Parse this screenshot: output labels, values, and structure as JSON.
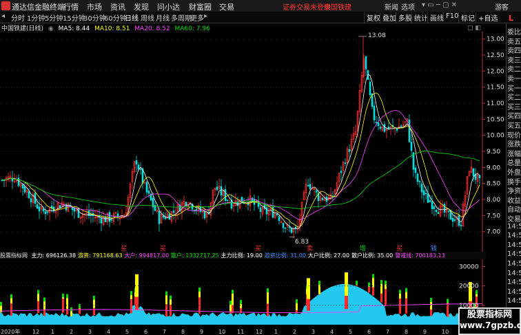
{
  "menu": {
    "app_title": "通达信金融终端",
    "items": [
      "行情",
      "市场",
      "资讯",
      "发现",
      "问小达",
      "财富圈",
      "交易"
    ],
    "warning": "证券交易未登录",
    "stock_link": "中国铁建",
    "right_items": [
      "新闻",
      "选项"
    ],
    "user": "游客"
  },
  "toolbar": {
    "periods": [
      "分时",
      "1分钟",
      "5分钟",
      "15分钟",
      "30分钟",
      "60分钟",
      "日线",
      "周线",
      "月线",
      "多周期",
      "更多"
    ],
    "active_period": "日线",
    "right_buttons": [
      "复权",
      "叠加",
      "多股",
      "统计",
      "画线",
      "F10",
      "标记",
      "+自选"
    ]
  },
  "legend": {
    "name": "中国铁建(日线)",
    "ma5": "MA5: 8.44",
    "ma10": "MA10: 8.51",
    "ma20": "MA20: 8.52",
    "ma60": "MA60: 7.96",
    "colors": {
      "ma5": "#ffffff",
      "ma10": "#ffff00",
      "ma20": "#ff44ff",
      "ma60": "#00dd00"
    }
  },
  "annotations": {
    "high": "13.08",
    "low": "6.83"
  },
  "signals": [
    "买",
    "买",
    "买",
    "卖",
    "增",
    "买",
    "钱"
  ],
  "price_axis": [
    "13.00",
    "12.50",
    "12.00",
    "11.50",
    "11.00",
    "10.50",
    "10.00",
    "9.50",
    "9.00",
    "8.50",
    "8.00",
    "7.50",
    "7.00"
  ],
  "indicator": {
    "name": "股票指标网",
    "fields": [
      {
        "label": "主力:",
        "value": "696126.38",
        "color": "#ffffff"
      },
      {
        "label": "游资:",
        "value": "791168.63",
        "color": "#ffff00"
      },
      {
        "label": "大户:",
        "value": "994817.00",
        "color": "#ff44ff"
      },
      {
        "label": "散户:",
        "value": "1332717.25",
        "color": "#00dd00"
      },
      {
        "label": "主力比例:",
        "value": "19.00",
        "color": "#ffffff"
      },
      {
        "label": "游资比例:",
        "value": "31.00",
        "color": "#4488ff"
      },
      {
        "label": "大户比例:",
        "value": "27.00",
        "color": "#ffffff"
      },
      {
        "label": "散户比例:",
        "value": "35.00",
        "color": "#ffffff"
      },
      {
        "label": "警戒线:",
        "value": "700183.13",
        "color": "#ff44ff"
      }
    ]
  },
  "indicator_axis": [
    "30000",
    "20000",
    "10000"
  ],
  "side_panel": [
    "委比",
    "卖五",
    "卖四",
    "卖三",
    "卖二",
    "卖一",
    "买一",
    "买二",
    "买三",
    "买四",
    "买五",
    "现价",
    "涨跌",
    "涨幅",
    "总量",
    "外盘",
    "换手",
    "净资",
    "收益",
    "自动",
    "交易",
    "14:50",
    "14:50",
    "14:50",
    "14:50",
    "14:50",
    "14:50",
    "14:50",
    "14:50",
    "14:50"
  ],
  "dates": [
    "2020年",
    "12",
    "1",
    "2",
    "3",
    "4",
    "5",
    "6",
    "7",
    "8",
    "9",
    "10",
    "11",
    "12",
    "1",
    "2",
    "3",
    "4",
    "5",
    "6",
    "7",
    "8",
    "9",
    "10",
    "11",
    "12"
  ],
  "watermark": {
    "line1": "股票指标网",
    "line2": "www.7gpzb.com"
  }
}
